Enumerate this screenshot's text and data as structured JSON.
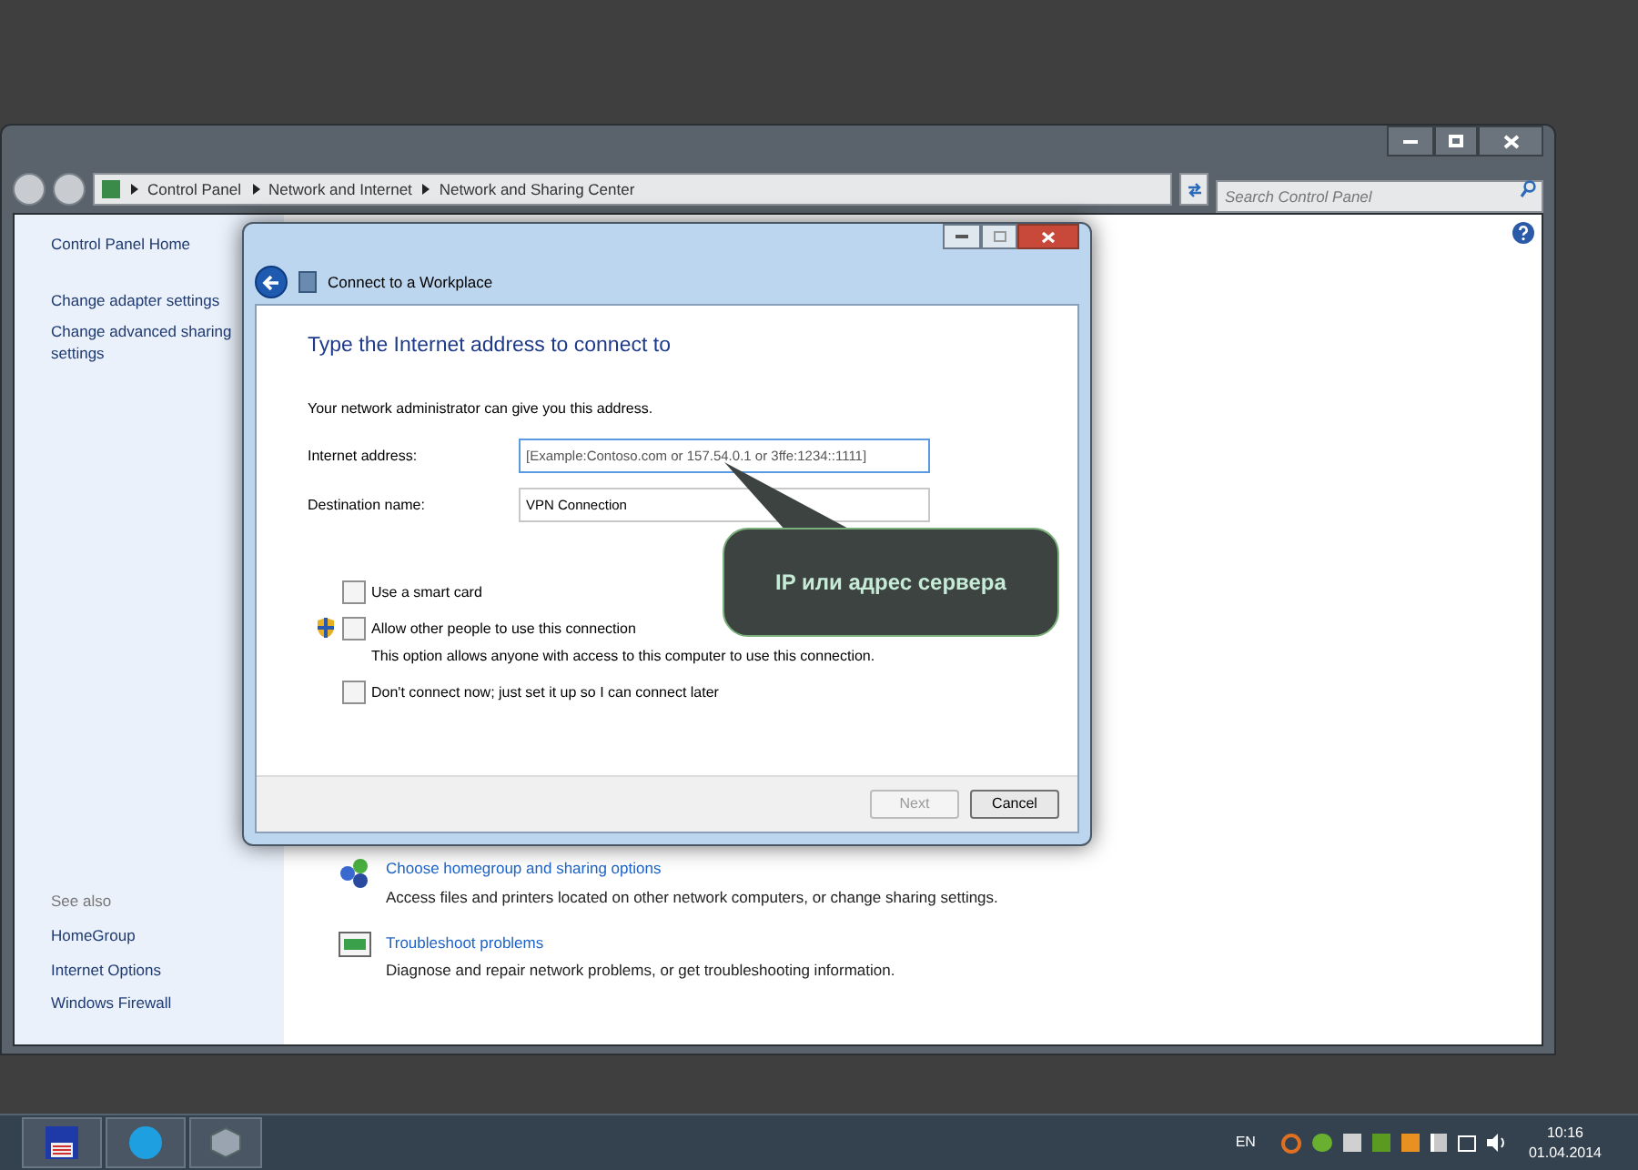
{
  "explorer": {
    "breadcrumb": [
      "Control Panel",
      "Network and Internet",
      "Network and Sharing Center"
    ],
    "search": {
      "placeholder": "Search Control Panel"
    }
  },
  "sidebar": {
    "items": [
      "Control Panel Home",
      "Change adapter settings",
      "Change advanced sharing settings"
    ],
    "see_also_title": "See also",
    "see_also": [
      "HomeGroup",
      "Internet Options",
      "Windows Firewall"
    ]
  },
  "tasks": [
    {
      "kind": "homegroup",
      "title": "Choose homegroup and sharing options",
      "description": "Access files and printers located on other network computers, or change sharing settings."
    },
    {
      "kind": "troubleshoot",
      "title": "Troubleshoot problems",
      "description": "Diagnose and repair network problems, or get troubleshooting information."
    }
  ],
  "dialog": {
    "title": "Connect to a Workplace",
    "heading": "Type the Internet address to connect to",
    "intro": "Your network administrator can give you this address.",
    "fields": [
      {
        "label": "Internet address:",
        "placeholder": "[Example:Contoso.com or 157.54.0.1 or 3ffe:1234::1111]",
        "focused": true
      },
      {
        "label": "Destination name:",
        "value": "VPN Connection",
        "focused": false
      }
    ],
    "options": [
      {
        "label": "Use a smart card",
        "checked": false,
        "shield": false
      },
      {
        "label": "Allow other people to use this connection",
        "checked": false,
        "shield": true,
        "description": "This option allows anyone with access to this computer to use this connection."
      },
      {
        "label": "Don't connect now; just set it up so I can connect later",
        "checked": false,
        "shield": false
      }
    ],
    "buttons": [
      {
        "label": "Next",
        "disabled": true
      },
      {
        "label": "Cancel",
        "disabled": false
      }
    ]
  },
  "callout": {
    "text": "IP или адрес сервера"
  },
  "taskbar": {
    "language": "EN",
    "time": "10:16",
    "date": "01.04.2014"
  }
}
